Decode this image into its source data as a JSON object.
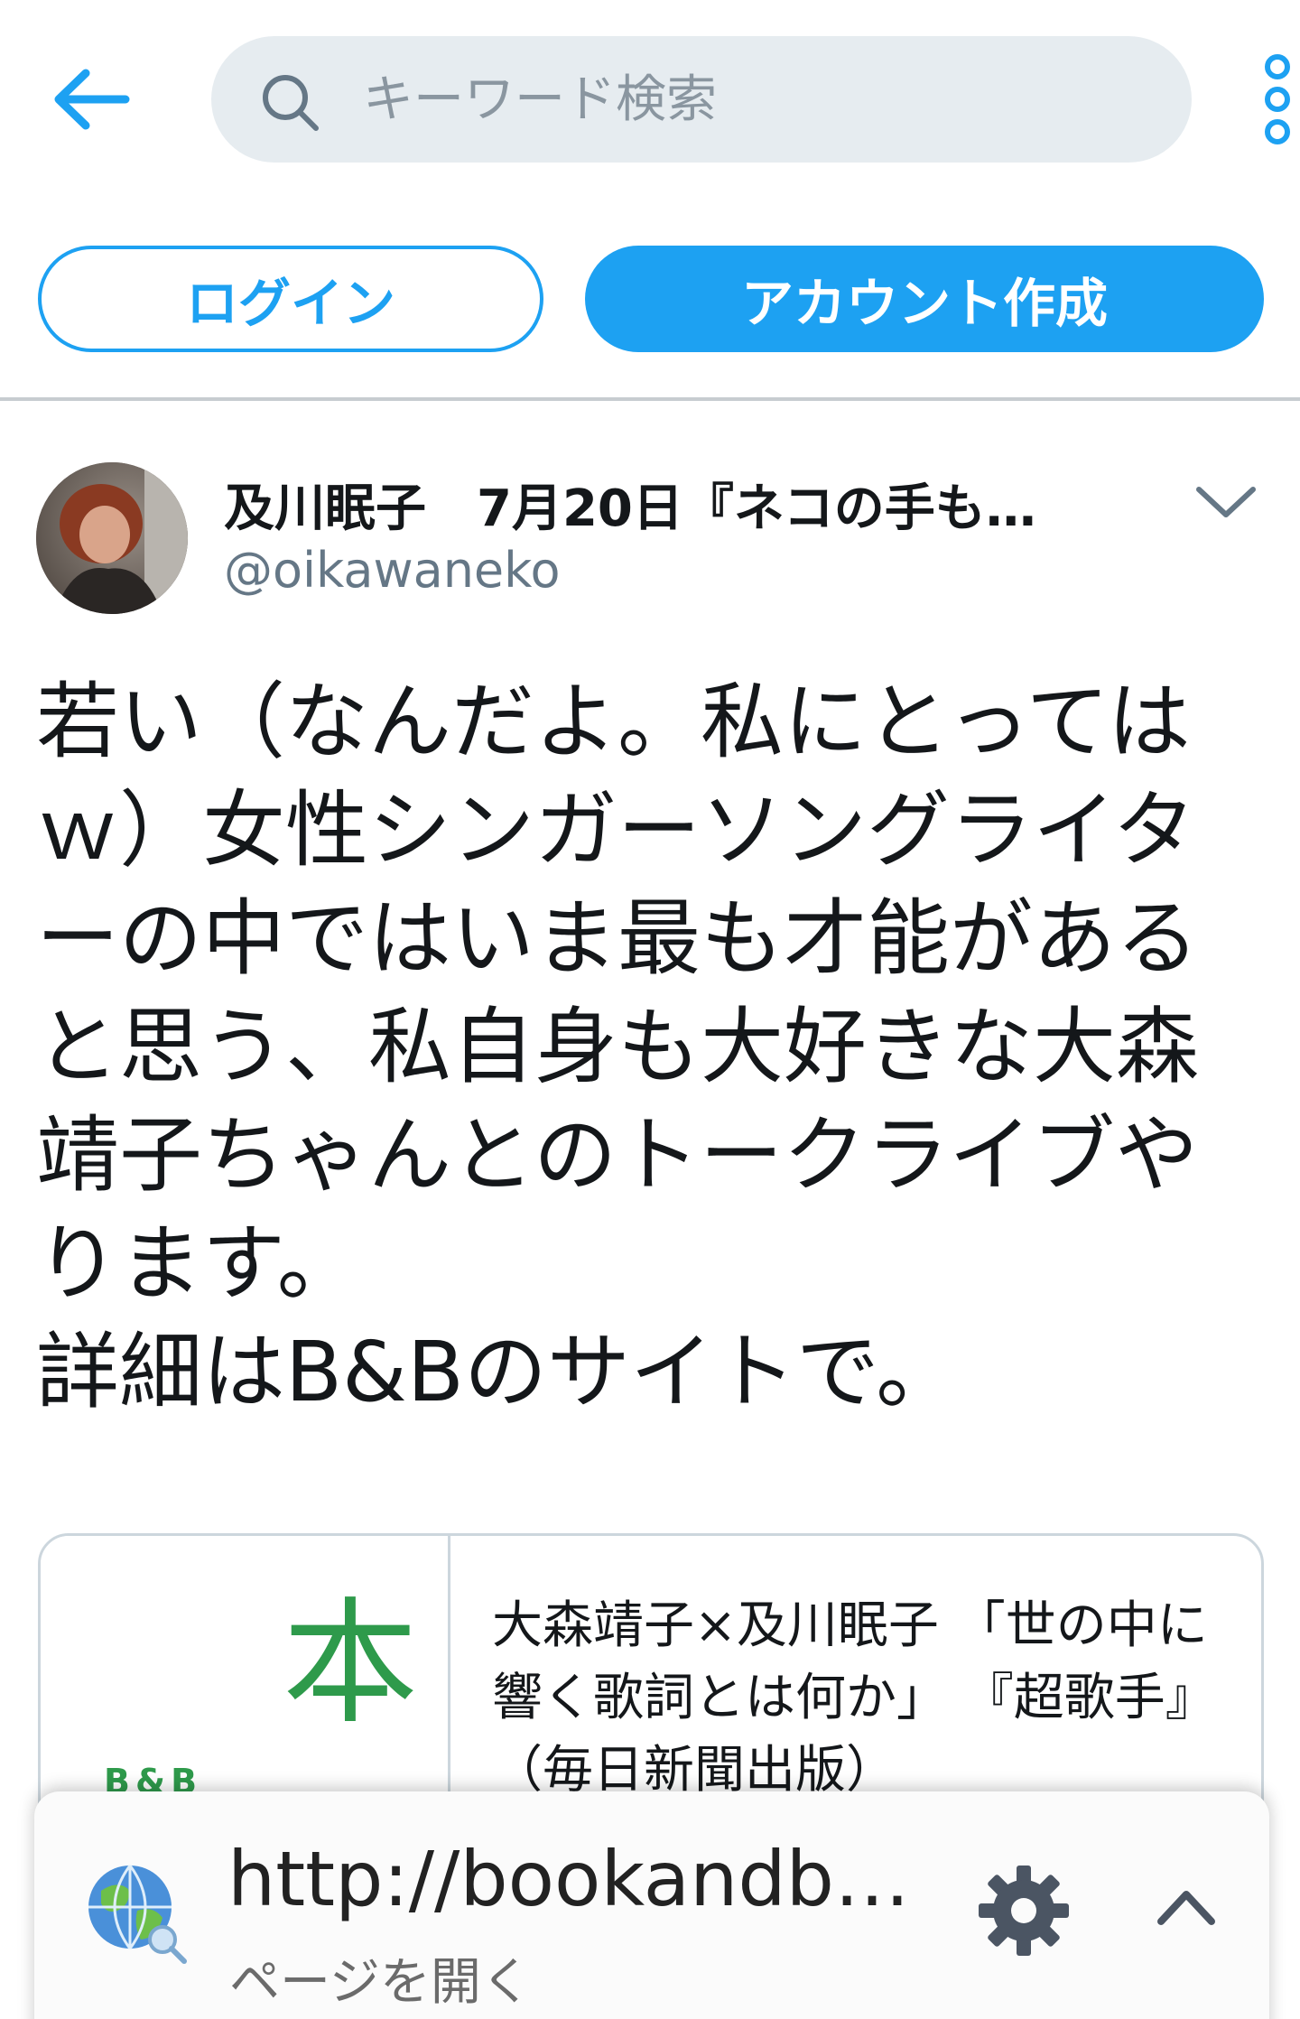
{
  "header": {
    "search_placeholder": "キーワード検索"
  },
  "auth": {
    "login_label": "ログイン",
    "signup_label": "アカウント作成"
  },
  "tweet": {
    "author_name": "及川眠子　7月20日『ネコの手も…",
    "author_handle": "@oikawaneko",
    "text": "若い（なんだよ。私にとっては\nｗ）女性シンガーソングライタ\nーの中ではいま最も才能がある\nと思う、私自身も大好きな大森\n靖子ちゃんとのトークライブや\nります。\n詳細はB&Bのサイトで。"
  },
  "card": {
    "thumb_kanji": "本",
    "thumb_text": "B&B",
    "title": "大森靖子×及川眠子 「世の中に響く歌詞とは何か」 『超歌手』（毎日新聞出版）"
  },
  "sheet": {
    "url": "http://bookandb…",
    "action": "ページを開く"
  },
  "colors": {
    "accent": "#1da1f2",
    "search_bg": "#e6ecf0",
    "card_green": "#2e9a4b"
  },
  "icons": [
    "back-arrow-icon",
    "search-icon",
    "more-vertical-icon",
    "chevron-down-icon",
    "globe-icon",
    "gear-icon",
    "chevron-up-icon"
  ]
}
